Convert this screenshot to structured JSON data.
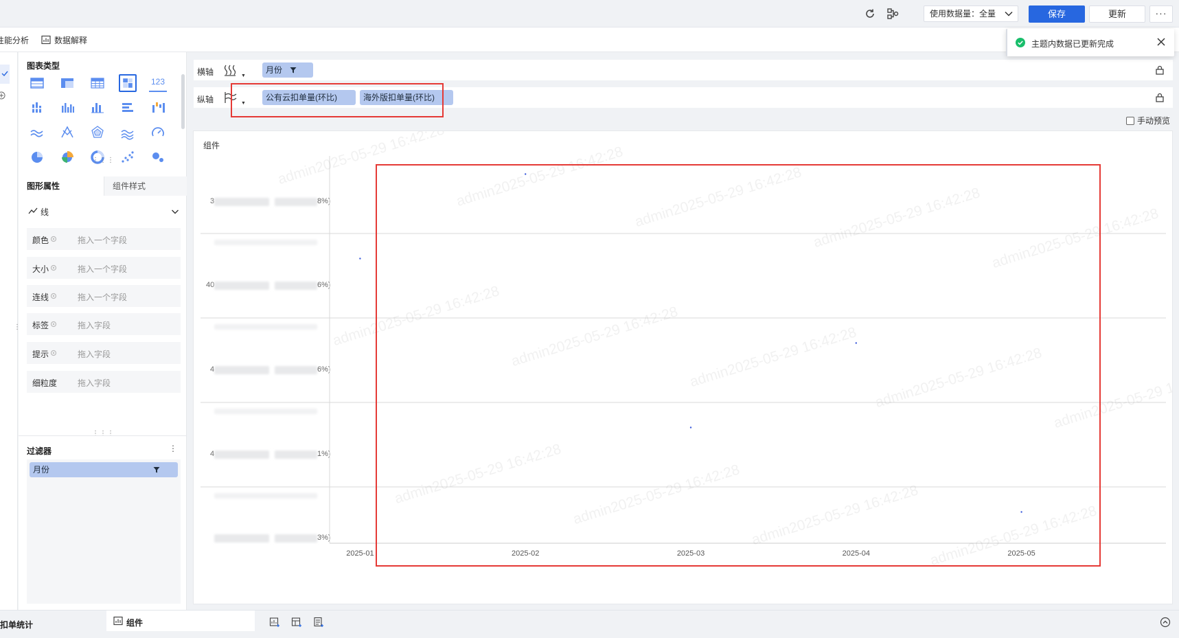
{
  "toolbar": {
    "data_amount_label": "使用数据量：全量",
    "save_label": "保存",
    "update_label": "更新",
    "more_label": "···"
  },
  "subbar": {
    "item1": "性能分析",
    "item2": "数据解释"
  },
  "notification": {
    "message": "主题内数据已更新完成"
  },
  "panel": {
    "chart_type_title": "图表类型",
    "number_icon_text": "123",
    "tabs": {
      "graph_attr": "图形属性",
      "component_style": "组件样式"
    },
    "mark_type": "线",
    "attributes": [
      {
        "label": "颜色",
        "placeholder": "拖入一个字段"
      },
      {
        "label": "大小",
        "placeholder": "拖入一个字段"
      },
      {
        "label": "连线",
        "placeholder": "拖入一个字段"
      },
      {
        "label": "标签",
        "placeholder": "拖入字段"
      },
      {
        "label": "提示",
        "placeholder": "拖入字段"
      },
      {
        "label": "细粒度",
        "placeholder": "拖入字段"
      }
    ],
    "filter_title": "过滤器",
    "filter_more": "⋮",
    "filter_field": "月份"
  },
  "shelves": {
    "x_label": "横轴",
    "y_label": "纵轴",
    "x_field": "月份",
    "y_fields": [
      "公有云扣单量(环比)",
      "海外版扣单量(环比)"
    ],
    "manual_preview": "手动预览"
  },
  "chart": {
    "component_title": "组件",
    "watermark": "admin2025-05-29 16:42:28",
    "y_edge_labels": [
      {
        "left": "3",
        "right": "8%)"
      },
      {
        "left": "40",
        "right": "6%)"
      },
      {
        "left": "4",
        "right": "6%)"
      },
      {
        "left": "4",
        "right": "1%)"
      },
      {
        "left": "",
        "right": "3%)"
      }
    ]
  },
  "chart_data": {
    "type": "scatter",
    "categories": [
      "2025-01",
      "2025-02",
      "2025-03",
      "2025-04",
      "2025-05"
    ],
    "series": [
      {
        "name": "公有云扣单量(环比)",
        "category_index": [
          0,
          1,
          2,
          3,
          4
        ],
        "row_index": [
          1,
          0,
          3,
          2,
          4
        ]
      }
    ],
    "row_count": 5,
    "point_color": "#3b5bdb",
    "grid": true
  },
  "bottom": {
    "tab1": "扣单统计",
    "tab2": "组件"
  },
  "colors": {
    "primary": "#2767e0",
    "pill": "#b4c8ef",
    "highlight": "#e53935",
    "success": "#19be6b"
  }
}
